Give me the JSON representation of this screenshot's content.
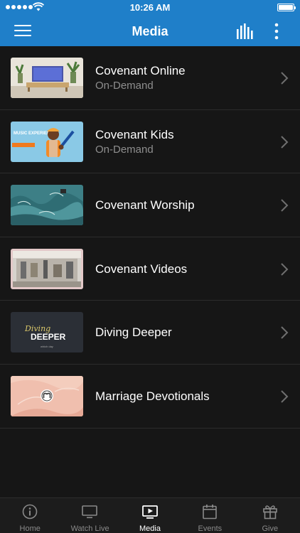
{
  "status_bar": {
    "time": "10:26 AM"
  },
  "header": {
    "title": "Media",
    "menu_icon": "hamburger-menu-icon",
    "equalizer_icon": "equalizer-icon",
    "more_icon": "more-vertical-icon"
  },
  "media_list": [
    {
      "title": "Covenant Online",
      "subtitle": "On-Demand"
    },
    {
      "title": "Covenant Kids",
      "subtitle": "On-Demand"
    },
    {
      "title": "Covenant Worship",
      "subtitle": ""
    },
    {
      "title": "Covenant Videos",
      "subtitle": ""
    },
    {
      "title": "Diving Deeper",
      "subtitle": ""
    },
    {
      "title": "Marriage Devotionals",
      "subtitle": ""
    }
  ],
  "thumb_text": {
    "kids": "MUSIC EXPERIENCE",
    "diving_script": "Diving",
    "diving_main": "DEEPER",
    "diving_footer": "which day"
  },
  "tabbar": {
    "active": "Media",
    "tabs": [
      {
        "label": "Home",
        "icon": "info-circle-icon"
      },
      {
        "label": "Watch Live",
        "icon": "monitor-icon"
      },
      {
        "label": "Media",
        "icon": "play-screen-icon"
      },
      {
        "label": "Events",
        "icon": "calendar-icon"
      },
      {
        "label": "Give",
        "icon": "gift-icon"
      }
    ]
  },
  "colors": {
    "header_blue": "#1f7fc9",
    "background": "#161616",
    "tabbar": "#1c1c1c",
    "subtitle_gray": "#8e8e8e"
  }
}
